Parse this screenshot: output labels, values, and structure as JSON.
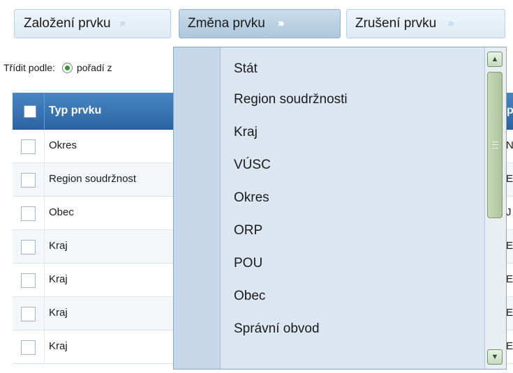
{
  "toolbar": {
    "create_label": "Založení prvku",
    "change_label": "Změna prvku",
    "cancel_label": "Zrušení prvku",
    "chevron": "»"
  },
  "sort": {
    "label": "Třídit podle:",
    "option_label": "pořadí z"
  },
  "grid": {
    "header_type": "Typ prvku",
    "header_col2": "p",
    "rows": [
      {
        "type": "Okres",
        "col2": "N"
      },
      {
        "type": "Region soudržnost",
        "col2": "E"
      },
      {
        "type": "Obec",
        "col2": "J"
      },
      {
        "type": "Kraj",
        "col2": "E"
      },
      {
        "type": "Kraj",
        "col2": "E"
      },
      {
        "type": "Kraj",
        "col2": "E"
      },
      {
        "type": "Kraj",
        "col2": "E"
      }
    ]
  },
  "dropdown": {
    "items": [
      "Stát",
      "Region soudržnosti",
      "Kraj",
      "VÚSC",
      "Okres",
      "ORP",
      "POU",
      "Obec",
      "Správní obvod"
    ],
    "scroll_up_icon": "arrow-up-icon",
    "scroll_down_icon": "arrow-down-icon"
  }
}
